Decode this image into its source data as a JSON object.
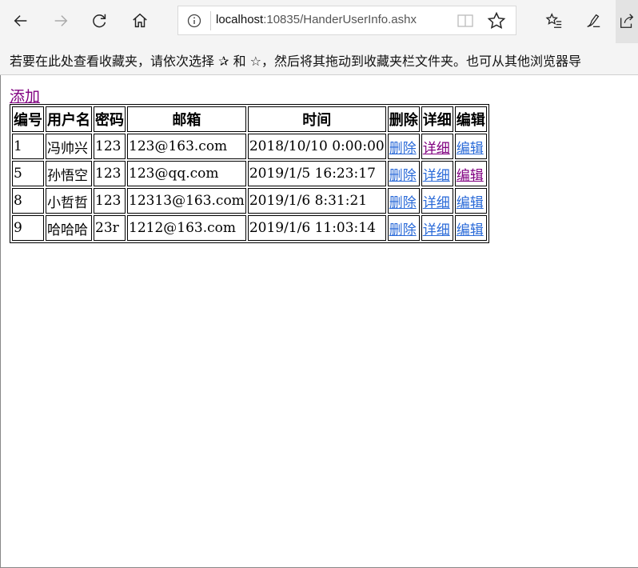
{
  "browser": {
    "url_host": "localhost",
    "url_rest": ":10835/HanderUserInfo.ashx",
    "favorites_message": "若要在此处查看收藏夹，请依次选择 ✰ 和 ☆，然后将其拖动到收藏夹栏文件夹。也可从其他浏览器导"
  },
  "page": {
    "add_link": "添加",
    "headers": [
      "编号",
      "用户名",
      "密码",
      "邮箱",
      "时间",
      "删除",
      "详细",
      "编辑"
    ],
    "rows": [
      {
        "id": "1",
        "username": "冯帅兴",
        "password": "123",
        "email": "123@163.com",
        "time": "2018/10/10 0:00:00",
        "delete": "删除",
        "detail": "详细",
        "edit": "编辑"
      },
      {
        "id": "5",
        "username": "孙悟空",
        "password": "123",
        "email": "123@qq.com",
        "time": "2019/1/5 16:23:17",
        "delete": "删除",
        "detail": "详细",
        "edit": "编辑"
      },
      {
        "id": "8",
        "username": "小哲哲",
        "password": "123",
        "email": "12313@163.com",
        "time": "2019/1/6 8:31:21",
        "delete": "删除",
        "detail": "详细",
        "edit": "编辑"
      },
      {
        "id": "9",
        "username": "哈哈哈",
        "password": "23r",
        "email": "1212@163.com",
        "time": "2019/1/6 11:03:14",
        "delete": "删除",
        "detail": "详细",
        "edit": "编辑"
      }
    ],
    "link_color": "#2a6ad8",
    "visited_color": "#800080"
  }
}
